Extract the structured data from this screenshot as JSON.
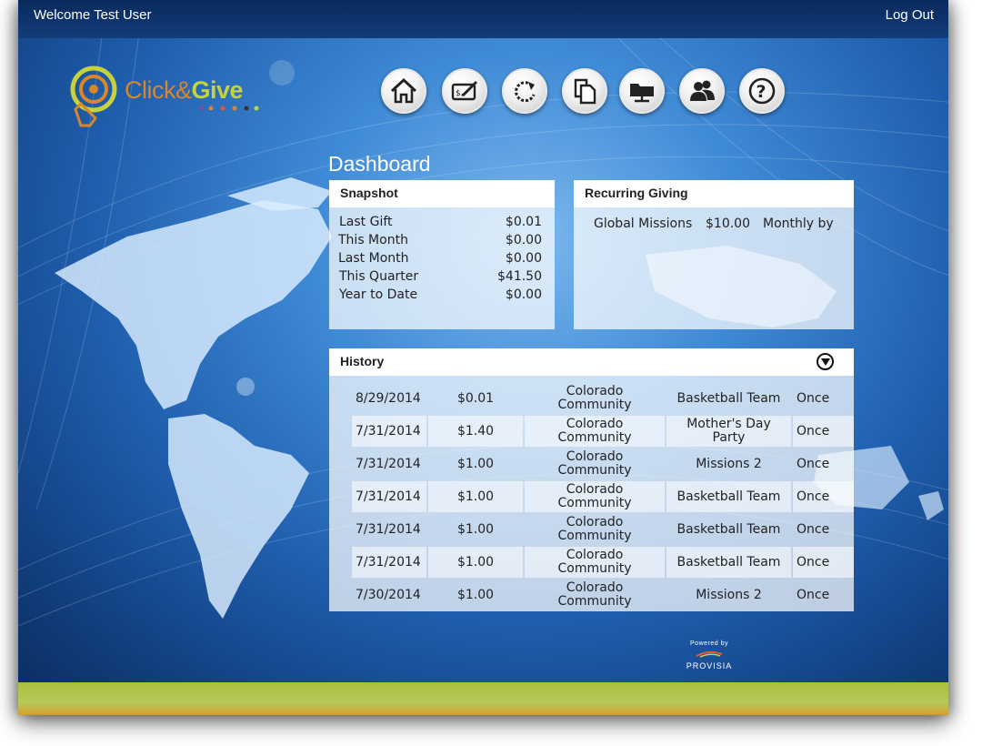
{
  "header": {
    "welcome": "Welcome Test User",
    "logout": "Log Out"
  },
  "brand": {
    "logo_click": "Click&",
    "logo_give": "Give",
    "powered_by": "Powered by",
    "vendor": "PROVISIA"
  },
  "nav": {
    "icons": [
      "home-icon",
      "checkbook-icon",
      "refresh-icon",
      "documents-icon",
      "folder-network-icon",
      "users-icon",
      "help-icon"
    ]
  },
  "page": {
    "title": "Dashboard"
  },
  "snapshot": {
    "title": "Snapshot",
    "rows": [
      {
        "label": "Last Gift",
        "value": "$0.01"
      },
      {
        "label": "This Month",
        "value": "$0.00"
      },
      {
        "label": "Last Month",
        "value": "$0.00"
      },
      {
        "label": "This Quarter",
        "value": "$41.50"
      },
      {
        "label": "Year to Date",
        "value": "$0.00"
      }
    ]
  },
  "recurring": {
    "title": "Recurring Giving",
    "rows": [
      {
        "fund": "Global Missions",
        "amount": "$10.00",
        "frequency": "Monthly by"
      }
    ]
  },
  "history": {
    "title": "History",
    "rows": [
      {
        "date": "8/29/2014",
        "amount": "$0.01",
        "fund_line1": "Colorado",
        "fund_line2": "Community",
        "program_line1": "Basketball Team",
        "program_line2": "",
        "frequency": "Once"
      },
      {
        "date": "7/31/2014",
        "amount": "$1.40",
        "fund_line1": "Colorado",
        "fund_line2": "Community",
        "program_line1": "Mother's Day",
        "program_line2": "Party",
        "frequency": "Once"
      },
      {
        "date": "7/31/2014",
        "amount": "$1.00",
        "fund_line1": "Colorado",
        "fund_line2": "Community",
        "program_line1": "Missions 2",
        "program_line2": "",
        "frequency": "Once"
      },
      {
        "date": "7/31/2014",
        "amount": "$1.00",
        "fund_line1": "Colorado",
        "fund_line2": "Community",
        "program_line1": "Basketball Team",
        "program_line2": "",
        "frequency": "Once"
      },
      {
        "date": "7/31/2014",
        "amount": "$1.00",
        "fund_line1": "Colorado",
        "fund_line2": "Community",
        "program_line1": "Basketball Team",
        "program_line2": "",
        "frequency": "Once"
      },
      {
        "date": "7/31/2014",
        "amount": "$1.00",
        "fund_line1": "Colorado",
        "fund_line2": "Community",
        "program_line1": "Basketball Team",
        "program_line2": "",
        "frequency": "Once"
      },
      {
        "date": "7/30/2014",
        "amount": "$1.00",
        "fund_line1": "Colorado",
        "fund_line2": "Community",
        "program_line1": "Missions 2",
        "program_line2": "",
        "frequency": "Once"
      }
    ]
  },
  "colors": {
    "brand_orange": "#d7862a",
    "brand_green": "#c7d13c",
    "header_navy": "#0a2a5c",
    "footer_olive": "#a9bf3c"
  }
}
